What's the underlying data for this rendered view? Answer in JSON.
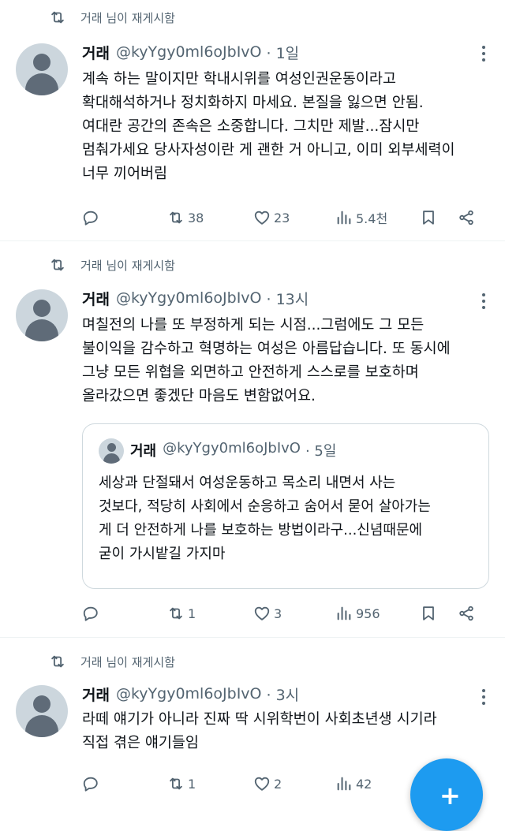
{
  "retweet_label": "거래 님이 재게시함",
  "colors": {
    "accent": "#1d9bf0",
    "secondary_text": "#536471"
  },
  "tweets": [
    {
      "name": "거래",
      "handle": "@kyYgy0ml6oJbIvO",
      "time": "· 1일",
      "text": "계속 하는 말이지만 학내시위를 여성인권운동이라고\n확대해석하거나 정치화하지 마세요. 본질을 잃으면 안됨.\n여대란 공간의 존속은 소중합니다. 그치만 제발...잠시만\n멈춰가세요 당사자성이란 게 괜한 거 아니고, 이미 외부세력이\n너무 끼어버림",
      "retweets": "38",
      "likes": "23",
      "views": "5.4천"
    },
    {
      "name": "거래",
      "handle": "@kyYgy0ml6oJbIvO",
      "time": "· 13시",
      "text": "며칠전의 나를 또 부정하게 되는 시점...그럼에도 그 모든\n불이익을 감수하고 혁명하는 여성은 아름답습니다. 또 동시에\n그냥 모든 위협을 외면하고 안전하게 스스로를 보호하며\n올라갔으면 좋겠단 마음도 변함없어요.",
      "quote": {
        "name": "거래",
        "handle": "@kyYgy0ml6oJbIvO",
        "time": "· 5일",
        "text": "세상과 단절돼서 여성운동하고 목소리 내면서 사는\n것보다, 적당히 사회에서 순응하고 숨어서 묻어 살아가는\n게 더 안전하게 나를 보호하는 방법이라구...신념때문에\n굳이 가시밭길 가지마"
      },
      "retweets": "1",
      "likes": "3",
      "views": "956"
    },
    {
      "name": "거래",
      "handle": "@kyYgy0ml6oJbIvO",
      "time": "· 3시",
      "text": "라떼 얘기가 아니라 진짜 딱 시위학번이 사회초년생 시기라\n직접 겪은 얘기들임",
      "retweets": "1",
      "likes": "2",
      "views": "42"
    }
  ],
  "fab": {
    "label": "+"
  }
}
